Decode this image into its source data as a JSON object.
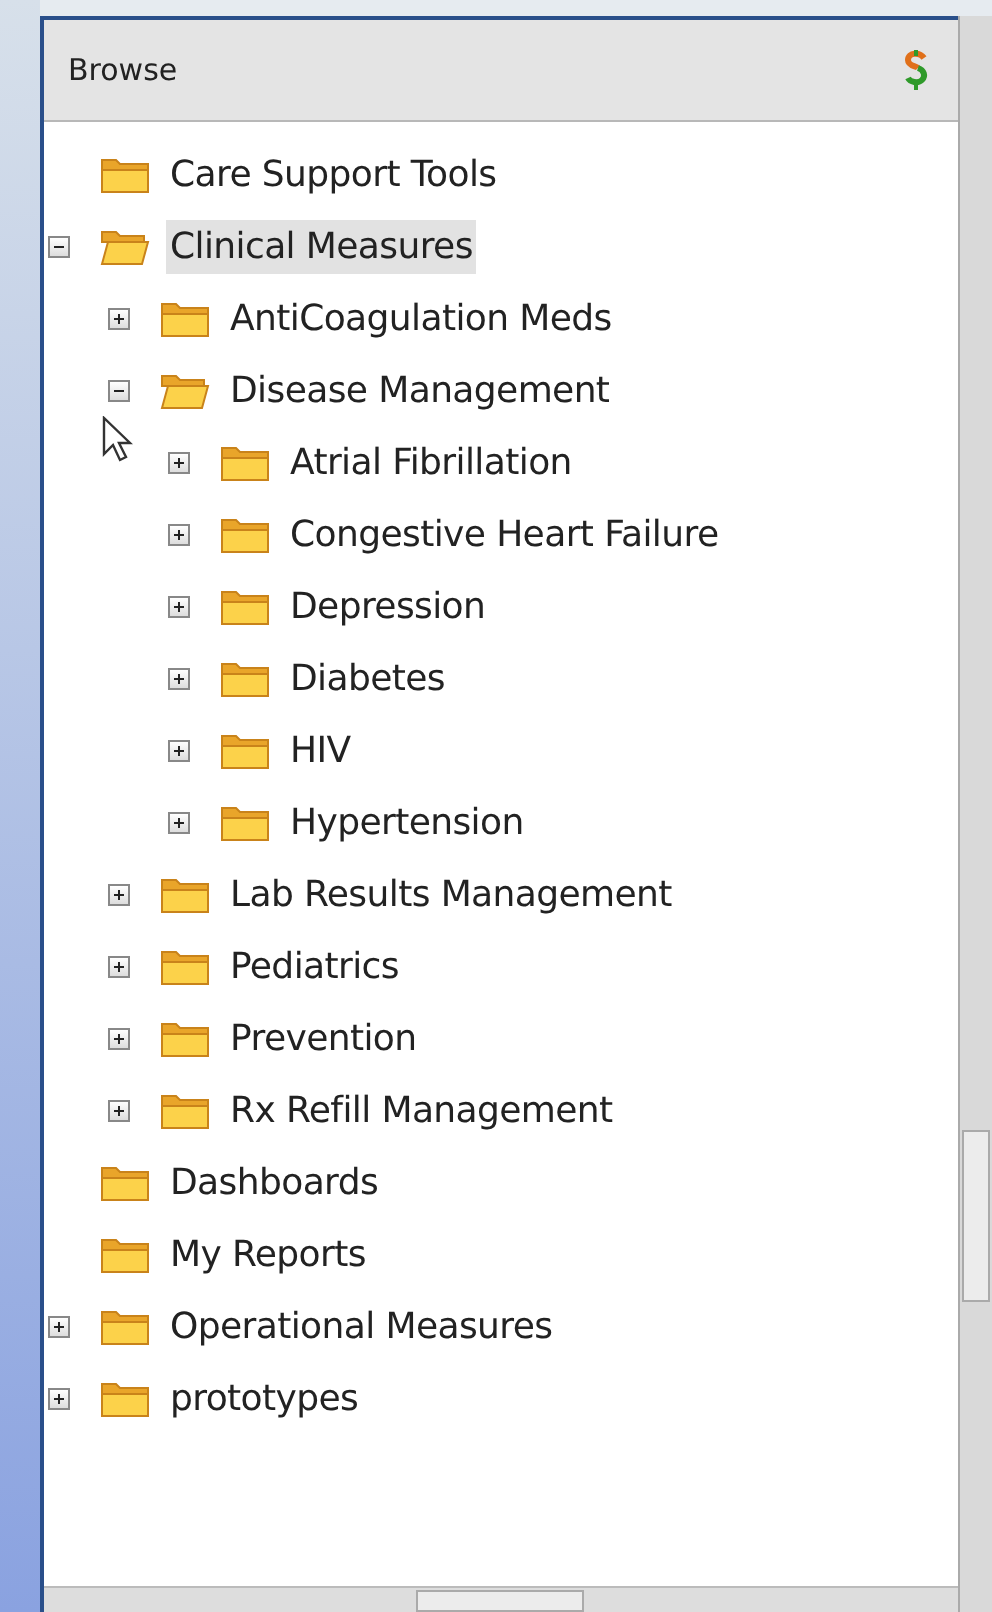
{
  "panel": {
    "title": "Browse"
  },
  "tree": [
    {
      "label": "Care Support Tools",
      "kind": "leaf",
      "selected": false
    },
    {
      "label": "Clinical Measures",
      "kind": "branch",
      "expanded": true,
      "selected": true,
      "children": [
        {
          "label": "AntiCoagulation Meds",
          "kind": "branch",
          "expanded": false,
          "selected": false
        },
        {
          "label": "Disease Management",
          "kind": "branch",
          "expanded": true,
          "selected": false,
          "children": [
            {
              "label": "Atrial Fibrillation",
              "kind": "branch",
              "expanded": false,
              "selected": false
            },
            {
              "label": "Congestive Heart Failure",
              "kind": "branch",
              "expanded": false,
              "selected": false
            },
            {
              "label": "Depression",
              "kind": "branch",
              "expanded": false,
              "selected": false
            },
            {
              "label": "Diabetes",
              "kind": "branch",
              "expanded": false,
              "selected": false
            },
            {
              "label": "HIV",
              "kind": "branch",
              "expanded": false,
              "selected": false
            },
            {
              "label": "Hypertension",
              "kind": "branch",
              "expanded": false,
              "selected": false
            }
          ]
        },
        {
          "label": "Lab Results Management",
          "kind": "branch",
          "expanded": false,
          "selected": false
        },
        {
          "label": "Pediatrics",
          "kind": "branch",
          "expanded": false,
          "selected": false
        },
        {
          "label": "Prevention",
          "kind": "branch",
          "expanded": false,
          "selected": false
        },
        {
          "label": "Rx Refill Management",
          "kind": "branch",
          "expanded": false,
          "selected": false
        }
      ]
    },
    {
      "label": "Dashboards",
      "kind": "leaf",
      "selected": false
    },
    {
      "label": "My Reports",
      "kind": "leaf",
      "selected": false
    },
    {
      "label": "Operational Measures",
      "kind": "branch",
      "expanded": false,
      "selected": false
    },
    {
      "label": "prototypes",
      "kind": "branch",
      "expanded": false,
      "selected": false
    }
  ]
}
